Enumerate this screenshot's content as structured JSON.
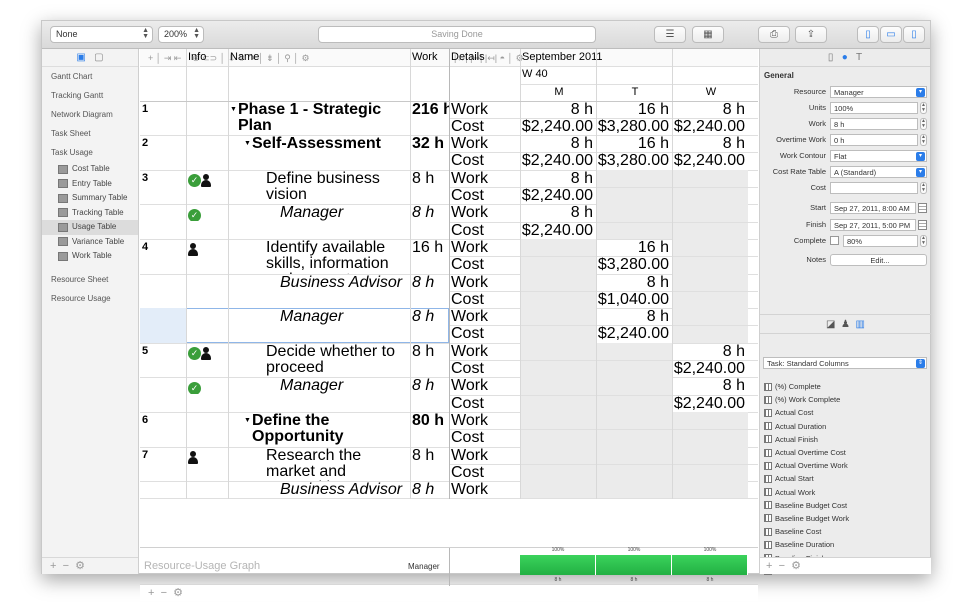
{
  "toolbar": {
    "view_select": "None",
    "zoom": "200%",
    "status": "Saving Done"
  },
  "sidebar": {
    "items": [
      {
        "label": "Gantt Chart"
      },
      {
        "label": "Tracking Gantt"
      },
      {
        "label": "Network Diagram"
      },
      {
        "label": "Task Sheet"
      },
      {
        "label": "Task Usage"
      }
    ],
    "subitems": [
      {
        "label": "Cost Table"
      },
      {
        "label": "Entry Table"
      },
      {
        "label": "Summary Table"
      },
      {
        "label": "Tracking Table"
      },
      {
        "label": "Usage Table"
      },
      {
        "label": "Variance Table"
      },
      {
        "label": "Work Table"
      }
    ],
    "items_after": [
      {
        "label": "Resource Sheet"
      },
      {
        "label": "Resource Usage"
      }
    ]
  },
  "table": {
    "headers": {
      "info": "Info",
      "name": "Name",
      "work": "Work",
      "details": "Details"
    },
    "timescale": {
      "month": "September 2011",
      "week": "W 40",
      "days": [
        "M",
        "T",
        "W"
      ]
    },
    "rows": [
      {
        "id": "1",
        "name": "Phase 1 - Strategic Plan",
        "work": "216 h",
        "bold": true,
        "italic": false,
        "indent": 0,
        "arrow": true,
        "icons": [],
        "lines": [
          {
            "d": "Work",
            "v": [
              "8 h",
              "16 h",
              "8 h"
            ]
          },
          {
            "d": "Cost",
            "v": [
              "$2,240.00",
              "$3,280.00",
              "$2,240.00"
            ]
          }
        ]
      },
      {
        "id": "2",
        "name": "Self-Assessment",
        "work": "32 h",
        "bold": true,
        "italic": false,
        "indent": 1,
        "arrow": true,
        "icons": [],
        "lines": [
          {
            "d": "Work",
            "v": [
              "8 h",
              "16 h",
              "8 h"
            ]
          },
          {
            "d": "Cost",
            "v": [
              "$2,240.00",
              "$3,280.00",
              "$2,240.00"
            ]
          }
        ]
      },
      {
        "id": "3",
        "name": "Define business vision",
        "work": "8 h",
        "bold": false,
        "italic": false,
        "indent": 2,
        "arrow": false,
        "icons": [
          "check",
          "person"
        ],
        "lines": [
          {
            "d": "Work",
            "v": [
              "8 h",
              "",
              ""
            ]
          },
          {
            "d": "Cost",
            "v": [
              "$2,240.00",
              "",
              ""
            ]
          }
        ]
      },
      {
        "id": "",
        "name": "Manager",
        "work": "8 h",
        "bold": false,
        "italic": true,
        "indent": 3,
        "arrow": false,
        "icons": [
          "check"
        ],
        "lines": [
          {
            "d": "Work",
            "v": [
              "8 h",
              "",
              ""
            ]
          },
          {
            "d": "Cost",
            "v": [
              "$2,240.00",
              "",
              ""
            ]
          }
        ]
      },
      {
        "id": "4",
        "name": "Identify available skills, information and support",
        "work": "16 h",
        "bold": false,
        "italic": false,
        "indent": 2,
        "arrow": false,
        "icons": [
          "person"
        ],
        "lines": [
          {
            "d": "Work",
            "v": [
              "",
              "16 h",
              ""
            ]
          },
          {
            "d": "Cost",
            "v": [
              "",
              "$3,280.00",
              ""
            ]
          }
        ]
      },
      {
        "id": "",
        "name": "Business Advisor",
        "work": "8 h",
        "bold": false,
        "italic": true,
        "indent": 3,
        "arrow": false,
        "icons": [],
        "lines": [
          {
            "d": "Work",
            "v": [
              "",
              "8 h",
              ""
            ]
          },
          {
            "d": "Cost",
            "v": [
              "",
              "$1,040.00",
              ""
            ]
          }
        ]
      },
      {
        "id": "",
        "name": "Manager",
        "work": "8 h",
        "bold": false,
        "italic": true,
        "indent": 3,
        "arrow": false,
        "icons": [],
        "selected": true,
        "lines": [
          {
            "d": "Work",
            "v": [
              "",
              "8 h",
              ""
            ]
          },
          {
            "d": "Cost",
            "v": [
              "",
              "$2,240.00",
              ""
            ]
          }
        ]
      },
      {
        "id": "5",
        "name": "Decide whether to proceed",
        "work": "8 h",
        "bold": false,
        "italic": false,
        "indent": 2,
        "arrow": false,
        "icons": [
          "check",
          "person"
        ],
        "lines": [
          {
            "d": "Work",
            "v": [
              "",
              "",
              "8 h"
            ]
          },
          {
            "d": "Cost",
            "v": [
              "",
              "",
              "$2,240.00"
            ]
          }
        ]
      },
      {
        "id": "",
        "name": "Manager",
        "work": "8 h",
        "bold": false,
        "italic": true,
        "indent": 3,
        "arrow": false,
        "icons": [
          "check"
        ],
        "lines": [
          {
            "d": "Work",
            "v": [
              "",
              "",
              "8 h"
            ]
          },
          {
            "d": "Cost",
            "v": [
              "",
              "",
              "$2,240.00"
            ]
          }
        ]
      },
      {
        "id": "6",
        "name": "Define the Opportunity",
        "work": "80 h",
        "bold": true,
        "italic": false,
        "indent": 1,
        "arrow": true,
        "icons": [],
        "lines": [
          {
            "d": "Work",
            "v": [
              "",
              "",
              ""
            ]
          },
          {
            "d": "Cost",
            "v": [
              "",
              "",
              ""
            ]
          }
        ]
      },
      {
        "id": "7",
        "name": "Research the market and competition",
        "work": "8 h",
        "bold": false,
        "italic": false,
        "indent": 2,
        "arrow": false,
        "icons": [
          "person"
        ],
        "lines": [
          {
            "d": "Work",
            "v": [
              "",
              "",
              ""
            ]
          },
          {
            "d": "Cost",
            "v": [
              "",
              "",
              ""
            ]
          }
        ]
      },
      {
        "id": "",
        "name": "Business Advisor",
        "work": "8 h",
        "bold": false,
        "italic": true,
        "indent": 3,
        "arrow": false,
        "icons": [],
        "lines": [
          {
            "d": "Work",
            "v": [
              "",
              "",
              ""
            ]
          }
        ]
      }
    ],
    "graph": {
      "label": "Resource-Usage Graph",
      "resource": "Manager",
      "bars": [
        {
          "top": "100%",
          "bottom": "8 h",
          "level": 1.0
        },
        {
          "top": "100%",
          "bottom": "8 h",
          "level": 1.0
        },
        {
          "top": "100%",
          "bottom": "8 h",
          "level": 1.0
        }
      ]
    }
  },
  "inspector": {
    "section": "General",
    "fields": [
      {
        "label": "Resource",
        "value": "Manager",
        "kind": "dropdown"
      },
      {
        "label": "Units",
        "value": "100%",
        "kind": "stepper"
      },
      {
        "label": "Work",
        "value": "8 h",
        "kind": "stepper"
      },
      {
        "label": "Overtime Work",
        "value": "0 h",
        "kind": "stepper"
      },
      {
        "label": "Work Contour",
        "value": "Flat",
        "kind": "dropdown"
      },
      {
        "label": "Cost Rate Table",
        "value": "A (Standard)",
        "kind": "dropdown"
      },
      {
        "label": "Cost",
        "value": "",
        "kind": "stepper"
      },
      {
        "label": "Start",
        "value": "Sep 27, 2011, 8:00 AM",
        "kind": "date"
      },
      {
        "label": "Finish",
        "value": "Sep 27, 2011, 5:00 PM",
        "kind": "date"
      },
      {
        "label": "Complete",
        "value": "80%",
        "kind": "complete"
      },
      {
        "label": "Notes",
        "value": "Edit...",
        "kind": "button"
      }
    ],
    "columns_select": "Task: Standard Columns",
    "columns": [
      "(%) Complete",
      "(%) Work Complete",
      "Actual Cost",
      "Actual Duration",
      "Actual Finish",
      "Actual Overtime Cost",
      "Actual Overtime Work",
      "Actual Start",
      "Actual Work",
      "Baseline Budget Cost",
      "Baseline Budget Work",
      "Baseline Cost",
      "Baseline Duration",
      "Baseline Finish",
      "Baseline Start"
    ]
  }
}
